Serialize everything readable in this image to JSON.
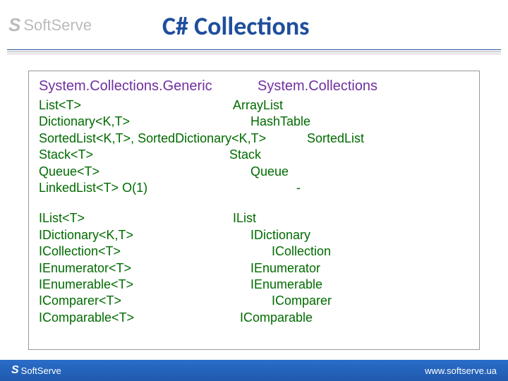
{
  "brand": "SoftServe",
  "title": "C# Collections",
  "headers": {
    "left": "System.Collections.Generic",
    "right": "System.Collections"
  },
  "rows1": [
    {
      "left": "List<T>",
      "right": "ArrayList",
      "lw": 275
    },
    {
      "left": "Dictionary<K,T>",
      "right": "HashTable",
      "lw": 300
    },
    {
      "left": "SortedList<K,T>, SortedDictionary<K,T>",
      "right": "SortedList",
      "lw": 380
    },
    {
      "left": " Stack<T>",
      "right": "Stack",
      "lw": 270
    },
    {
      "left": "Queue<T>",
      "right": "Queue",
      "lw": 300
    },
    {
      "left": "LinkedList<T>   O(1)",
      "right": "-",
      "lw": 365
    }
  ],
  "rows2": [
    {
      "left": "IList<T>",
      "right": "IList",
      "lw": 275
    },
    {
      "left": "IDictionary<K,T>",
      "right": "IDictionary",
      "lw": 300
    },
    {
      "left": "ICollection<T>",
      "right": "ICollection",
      "lw": 330
    },
    {
      "left": "IEnumerator<T>",
      "right": "IEnumerator",
      "lw": 300
    },
    {
      "left": "IEnumerable<T>",
      "right": "IEnumerable",
      "lw": 300
    },
    {
      "left": "IComparer<T>",
      "right": "IComparer",
      "lw": 330
    },
    {
      "left": "IComparable<T>",
      "right": "IComparable",
      "lw": 285
    }
  ],
  "footer_url": "www.softserve.ua"
}
